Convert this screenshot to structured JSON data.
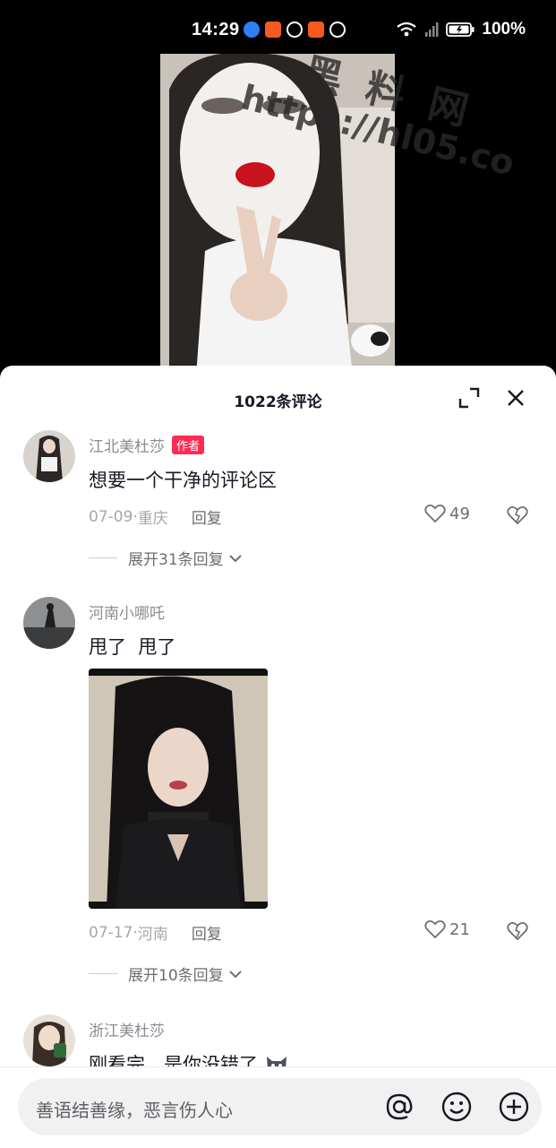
{
  "status_bar": {
    "time": "14:29",
    "battery": "100%",
    "app_icons": [
      "app-icon-blue",
      "app-icon-orange",
      "app-icon-signal",
      "app-icon-orange",
      "app-icon-clock"
    ]
  },
  "watermark": {
    "cjk": "黑料网",
    "url": "https://hl05.co"
  },
  "sheet": {
    "title": "1022条评论"
  },
  "comments": [
    {
      "user": "江北美杜莎",
      "badge": "作者",
      "text": "想要一个干净的评论区",
      "date": "07-09",
      "location": "重庆",
      "reply": "回复",
      "likes": "49",
      "expand": "展开31条回复"
    },
    {
      "user": "河南小哪吒",
      "text": "甩了  甩了",
      "date": "07-17",
      "location": "河南",
      "reply": "回复",
      "likes": "21",
      "expand": "展开10条回复"
    },
    {
      "user": "浙江美杜莎",
      "text": "刚看完，是你没错了"
    }
  ],
  "meta_separator": " · ",
  "input": {
    "placeholder": "善语结善缘，恶言伤人心"
  },
  "colors": {
    "accent": "#fe2c55",
    "text": "#161823",
    "muted": "#8a8b91"
  }
}
